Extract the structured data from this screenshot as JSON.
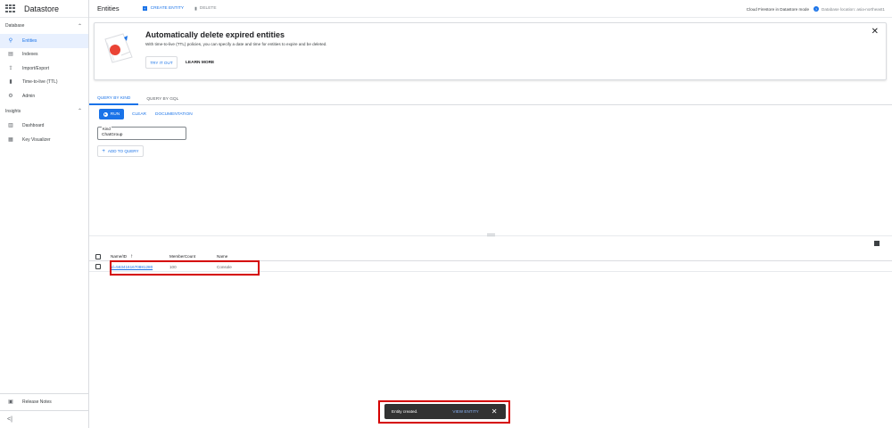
{
  "app": {
    "title": "Datastore"
  },
  "sidebar": {
    "database_header": "Database",
    "database_items": [
      {
        "label": "Entities",
        "icon": "search-icon"
      },
      {
        "label": "Indexes",
        "icon": "index-icon"
      },
      {
        "label": "Import/Export",
        "icon": "import-export-icon"
      },
      {
        "label": "Time-to-live (TTL)",
        "icon": "trash-icon"
      },
      {
        "label": "Admin",
        "icon": "gear-icon"
      }
    ],
    "insights_header": "Insights",
    "insights_items": [
      {
        "label": "Dashboard",
        "icon": "bar-chart-icon"
      },
      {
        "label": "Key Visualizer",
        "icon": "grid-icon"
      }
    ],
    "release_notes": "Release Notes"
  },
  "header": {
    "title": "Entities",
    "create_label": "CREATE ENTITY",
    "delete_label": "DELETE",
    "mode_text": "Cloud Firestore in Datastore mode",
    "location_text": "Database location: asia-northeast1"
  },
  "banner": {
    "title": "Automatically delete expired entities",
    "text": "With time-to-live (TTL) policies, you can specify a date and time for entities to expire and be deleted.",
    "try_label": "TRY IT OUT",
    "learn_label": "LEARN MORE"
  },
  "tabs": [
    {
      "label": "QUERY BY KIND",
      "active": true
    },
    {
      "label": "QUERY BY GQL",
      "active": false
    }
  ],
  "query": {
    "run_label": "RUN",
    "clear_label": "CLEAR",
    "docs_label": "DOCUMENTATION",
    "kind_label": "Kind",
    "kind_value": "ChatGroup",
    "add_label": "ADD TO QUERY"
  },
  "table": {
    "columns": [
      "Name/ID",
      "MemberCount",
      "Name"
    ],
    "rows": [
      {
        "id": "id=5634161670881280",
        "member_count": "100",
        "name": "Console"
      }
    ]
  },
  "snackbar": {
    "message": "Entity created.",
    "action": "VIEW ENTITY"
  },
  "colors": {
    "accent": "#1a73e8",
    "highlight": "#d50000",
    "snackbar": "#323232"
  }
}
